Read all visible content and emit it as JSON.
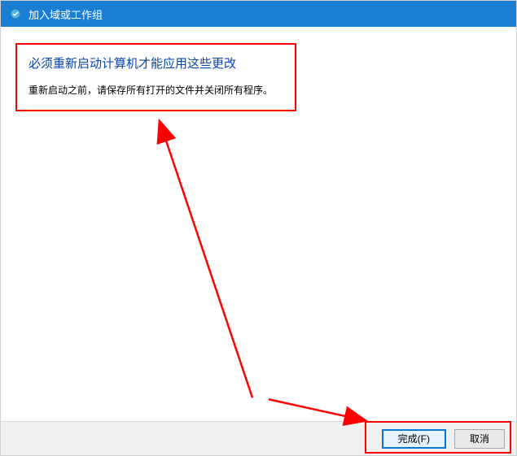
{
  "window": {
    "title": "加入域或工作组"
  },
  "content": {
    "heading": "必须重新启动计算机才能应用这些更改",
    "body": "重新启动之前，请保存所有打开的文件并关闭所有程序。"
  },
  "buttons": {
    "finish": "完成(F)",
    "cancel": "取消"
  }
}
